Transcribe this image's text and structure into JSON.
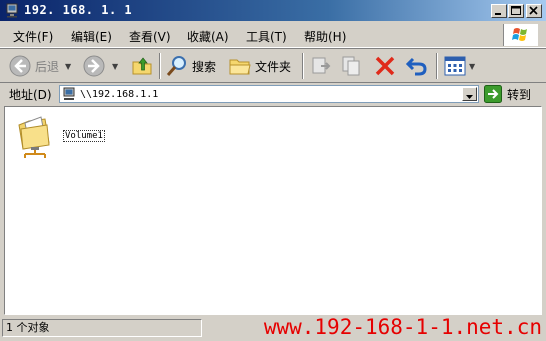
{
  "window": {
    "title": "192. 168. 1. 1",
    "minimize_icon": "minimize-icon",
    "maximize_icon": "maximize-icon",
    "close_icon": "close-icon"
  },
  "menu": {
    "items": [
      "文件(F)",
      "编辑(E)",
      "查看(V)",
      "收藏(A)",
      "工具(T)",
      "帮助(H)"
    ]
  },
  "toolbar": {
    "back_label": "后退",
    "search_label": "搜索",
    "folders_label": "文件夹"
  },
  "address": {
    "label": "地址(D)",
    "value": "\\\\192.168.1.1",
    "go_label": "转到"
  },
  "content": {
    "items": [
      {
        "label": "Volume1",
        "icon": "shared-folder-icon"
      }
    ]
  },
  "status": {
    "text": "1 个对象"
  },
  "watermark": "www.192-168-1-1.net.cn"
}
